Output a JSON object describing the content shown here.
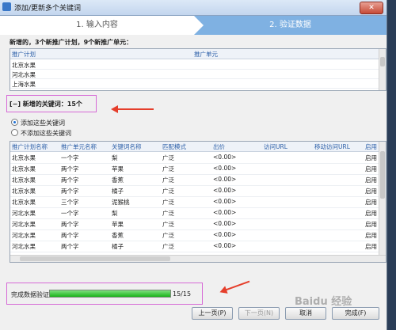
{
  "window": {
    "title": "添加/更新多个关键词",
    "close_label": "✕"
  },
  "wizard": {
    "step1": "1. 输入内容",
    "step2": "2. 验证数据"
  },
  "summary": "新增的，3个新推广计划，9个新推广单元：",
  "units_table": {
    "columns": [
      "推广计划",
      "推广单元"
    ],
    "rows": [
      [
        "北京水果",
        ""
      ],
      [
        "河北水果",
        ""
      ],
      [
        "上海水果",
        ""
      ]
    ]
  },
  "keywords_header": "[−] 新增的关键词：15个",
  "radio_options": {
    "add": "添加这些关键词",
    "skip": "不添加这些关键词",
    "selected": "add"
  },
  "keywords_table": {
    "columns": [
      "推广计划名称",
      "推广单元名称",
      "关键词名称",
      "匹配模式",
      "出价",
      "访问URL",
      "移动访问URL",
      "启用"
    ],
    "rows": [
      [
        "北京水果",
        "一个字",
        "梨",
        "广泛",
        "<0.00>",
        "",
        "",
        "启用"
      ],
      [
        "北京水果",
        "两个字",
        "苹果",
        "广泛",
        "<0.00>",
        "",
        "",
        "启用"
      ],
      [
        "北京水果",
        "两个字",
        "香蕉",
        "广泛",
        "<0.00>",
        "",
        "",
        "启用"
      ],
      [
        "北京水果",
        "两个字",
        "橘子",
        "广泛",
        "<0.00>",
        "",
        "",
        "启用"
      ],
      [
        "北京水果",
        "三个字",
        "泥猴桃",
        "广泛",
        "<0.00>",
        "",
        "",
        "启用"
      ],
      [
        "河北水果",
        "一个字",
        "梨",
        "广泛",
        "<0.00>",
        "",
        "",
        "启用"
      ],
      [
        "河北水果",
        "两个字",
        "苹果",
        "广泛",
        "<0.00>",
        "",
        "",
        "启用"
      ],
      [
        "河北水果",
        "两个字",
        "香蕉",
        "广泛",
        "<0.00>",
        "",
        "",
        "启用"
      ],
      [
        "河北水果",
        "两个字",
        "橘子",
        "广泛",
        "<0.00>",
        "",
        "",
        "启用"
      ]
    ]
  },
  "progress": {
    "label": "完成数据验证",
    "count": "15/15",
    "fraction": 1.0
  },
  "buttons": {
    "prev": "上一页(P)",
    "next": "下一页(N)",
    "cancel": "取消",
    "finish": "完成(F)"
  },
  "watermark": "Baidu 经验",
  "colors": {
    "step_active": "#7fb1e2",
    "progress_fill": "#19b419",
    "highlight": "#d66ad6",
    "arrow": "#e53e2b"
  }
}
